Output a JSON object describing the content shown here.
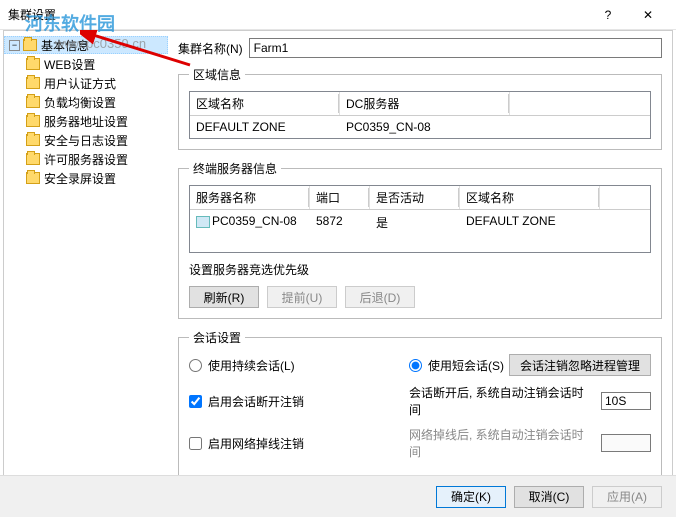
{
  "window": {
    "title": "集群设置",
    "help": "?",
    "close": "✕"
  },
  "watermark": {
    "text": "河东软件园",
    "url": "www.pc0359.cn"
  },
  "tree": {
    "root": "基本信息",
    "items": [
      "WEB设置",
      "用户认证方式",
      "负载均衡设置",
      "服务器地址设置",
      "安全与日志设置",
      "许可服务器设置",
      "安全录屏设置"
    ]
  },
  "cluster": {
    "label": "集群名称(N)",
    "value": "Farm1"
  },
  "zone": {
    "legend": "区域信息",
    "headers": [
      "区域名称",
      "DC服务器"
    ],
    "row": [
      "DEFAULT ZONE",
      "PC0359_CN-08"
    ]
  },
  "terminal": {
    "legend": "终端服务器信息",
    "headers": [
      "服务器名称",
      "端口",
      "是否活动",
      "区域名称"
    ],
    "row": [
      "PC0359_CN-08",
      "5872",
      "是",
      "DEFAULT ZONE"
    ],
    "priority_label": "设置服务器竞选优先级",
    "refresh": "刷新(R)",
    "up": "提前(U)",
    "down": "后退(D)"
  },
  "session": {
    "legend": "会话设置",
    "persistent": "使用持续会话(L)",
    "short": "使用短会话(S)",
    "ignore_btn": "会话注销忽略进程管理",
    "logout_on_disconnect": "启用会话断开注销",
    "disconnect_label": "会话断开后, 系统自动注销会话时间",
    "disconnect_timeout": "10S",
    "logout_on_netdown": "启用网络掉线注销",
    "netdown_label": "网络掉线后, 系统自动注销会话时间"
  },
  "footer": {
    "ok": "确定(K)",
    "cancel": "取消(C)",
    "apply": "应用(A)"
  }
}
